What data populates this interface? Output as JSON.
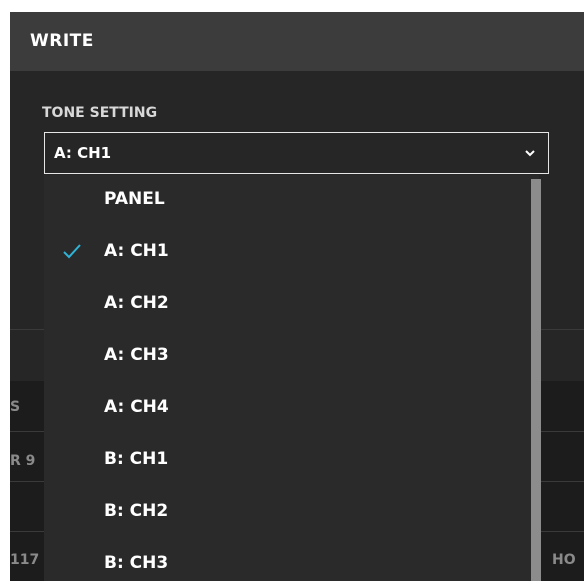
{
  "header": {
    "title": "WRITE"
  },
  "tone_setting": {
    "label": "TONE SETTING",
    "selected": "A: CH1",
    "options": [
      {
        "label": "PANEL",
        "checked": false
      },
      {
        "label": "A: CH1",
        "checked": true
      },
      {
        "label": "A: CH2",
        "checked": false
      },
      {
        "label": "A: CH3",
        "checked": false
      },
      {
        "label": "A: CH4",
        "checked": false
      },
      {
        "label": "B: CH1",
        "checked": false
      },
      {
        "label": "B: CH2",
        "checked": false
      },
      {
        "label": "B: CH3",
        "checked": false
      }
    ]
  },
  "background_table": {
    "row1": "S",
    "row2": "R 9",
    "row3": "117",
    "row3_right": "HO"
  },
  "colors": {
    "check": "#2fb3d6",
    "header_bg": "#3c3c3c",
    "panel_bg": "#262626"
  },
  "icons": {
    "select_arrow": "chevron-down-icon",
    "selected_mark": "check-icon"
  }
}
